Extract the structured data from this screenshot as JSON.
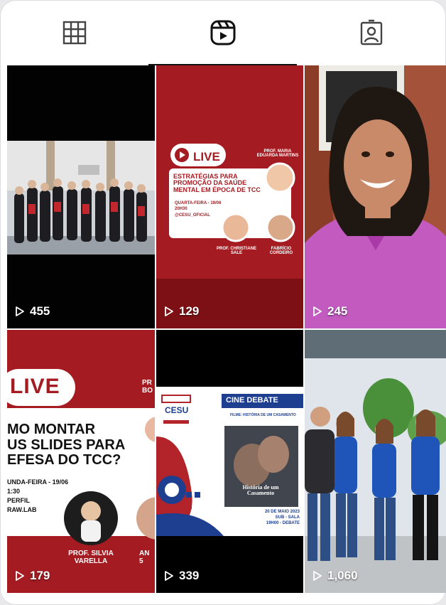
{
  "tabs": [
    {
      "icon": "grid-icon",
      "label": "Posts"
    },
    {
      "icon": "reels-icon",
      "label": "Reels"
    },
    {
      "icon": "tagged-icon",
      "label": "Tagged"
    }
  ],
  "reels": [
    {
      "views": "455"
    },
    {
      "views": "129",
      "badge": "LIVE",
      "host_label": "PROF. MARIA EDUARDA MARTINS",
      "title": "ESTRATÉGIAS PARA PROMOÇÃO DA SAÚDE MENTAL EM ÉPOCA DE TCC",
      "details": [
        "QUARTA-FEIRA - 19/06",
        "20H30",
        "@CESU_OFICIAL"
      ],
      "guest1": "PROF. CHRISTIANE SALE",
      "guest2": "FABRÍCIO CORDEIRO"
    },
    {
      "views": "245"
    },
    {
      "views": "179",
      "badge": "LIVE",
      "title_lines": [
        "MO MONTAR",
        "US SLIDES PARA",
        "EFESA DO TCC?"
      ],
      "details": [
        "UNDA-FEIRA - 19/06",
        "1:30",
        "PERFIL",
        "RAW.LAB"
      ],
      "speaker": "PROF. SILVIA VARELLA",
      "right_fragment_top": "PR BO",
      "right_fragment_bottom": "AN 5"
    },
    {
      "views": "339",
      "logo": "CESU",
      "event": "CINE DEBATE",
      "film_line": "FILME: HISTÓRIA DE UM CASAMENTO",
      "poster_title": "História de um Casamento",
      "date_line": "20 DE MAIO 2023",
      "place_line": "SUB - SALA",
      "time_line": "19H00 - DEBATE"
    },
    {
      "views": "1,060"
    }
  ]
}
